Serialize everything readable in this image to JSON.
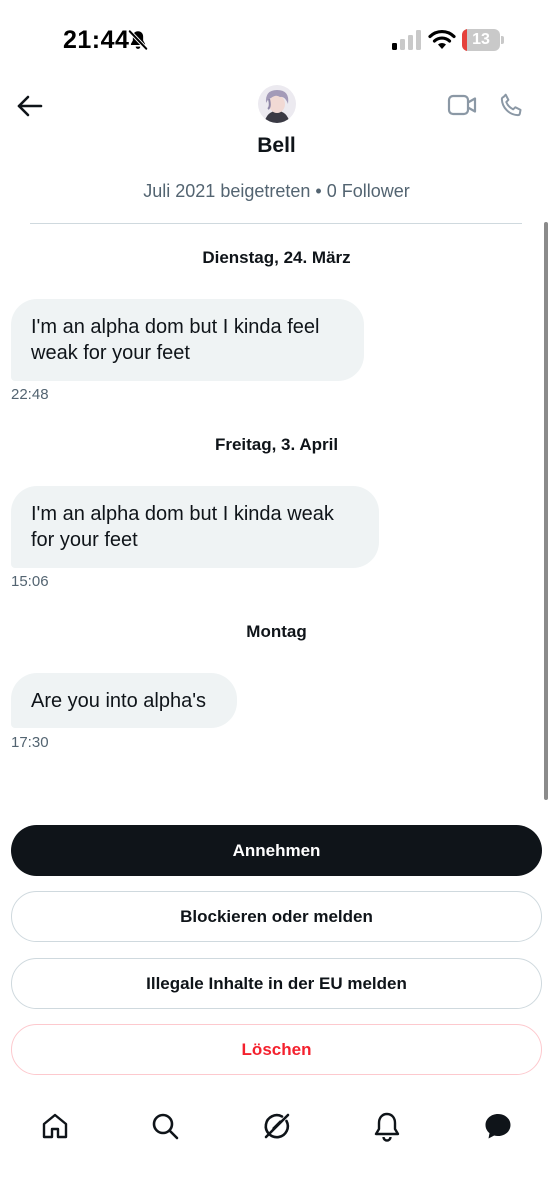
{
  "status_bar": {
    "time": "21:44",
    "battery_level": "13",
    "battery_fraction": 0.13,
    "battery_color": "#e5413b",
    "icons": [
      "bell-slash-icon",
      "cellular-signal-icon",
      "wifi-icon",
      "battery-icon"
    ]
  },
  "header": {
    "icons": [
      "back-arrow-icon",
      "video-call-icon",
      "phone-icon"
    ],
    "name": "Bell",
    "meta": "Juli 2021 beigetreten • 0 Follower"
  },
  "conversation": {
    "groups": [
      {
        "date": "Dienstag, 24. März",
        "message": "I'm an alpha dom but I kinda feel weak for your feet",
        "time": "22:48"
      },
      {
        "date": "Freitag, 3. April",
        "message": "I'm an alpha dom but I kinda weak for your feet",
        "time": "15:06"
      },
      {
        "date": "Montag",
        "message": "Are you into alpha's",
        "time": "17:30"
      }
    ]
  },
  "actions": {
    "accept": "Annehmen",
    "block_report": "Blockieren oder melden",
    "report_eu": "Illegale Inhalte in der EU melden",
    "delete": "Löschen",
    "delete_color": "#f4212e"
  },
  "tab_bar": {
    "icons": [
      "home-icon",
      "search-icon",
      "grok-icon",
      "notifications-icon",
      "messages-icon"
    ]
  },
  "colors": {
    "text_primary": "#0f1419",
    "text_secondary": "#536471",
    "bubble_bg": "#eff3f4",
    "border": "#cfd9de"
  }
}
